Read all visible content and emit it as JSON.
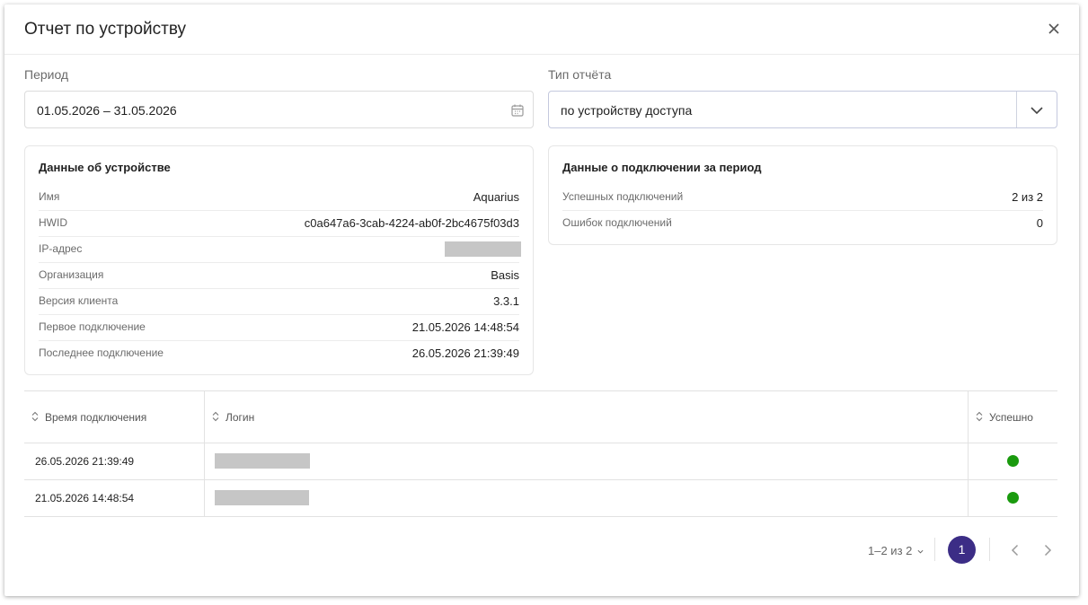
{
  "dialog": {
    "title": "Отчет по устройству"
  },
  "filters": {
    "period_label": "Период",
    "period_value": "01.05.2026 – 31.05.2026",
    "report_type_label": "Тип отчёта",
    "report_type_value": "по устройству доступа"
  },
  "device": {
    "title": "Данные об устройстве",
    "rows": [
      {
        "key": "Имя",
        "value": "Aquarius"
      },
      {
        "key": "HWID",
        "value": "c0a647a6-3cab-4224-ab0f-2bc4675f03d3"
      },
      {
        "key": "IP-адрес",
        "value": ""
      },
      {
        "key": "Организация",
        "value": "Basis"
      },
      {
        "key": "Версия клиента",
        "value": "3.3.1"
      },
      {
        "key": "Первое подключение",
        "value": "21.05.2026 14:48:54"
      },
      {
        "key": "Последнее подключение",
        "value": "26.05.2026 21:39:49"
      }
    ]
  },
  "connections": {
    "title": "Данные о подключении за период",
    "rows": [
      {
        "key": "Успешных подключений",
        "value": "2 из 2"
      },
      {
        "key": "Ошибок подключений",
        "value": "0"
      }
    ]
  },
  "table": {
    "headers": [
      "Время подключения",
      "Логин",
      "Успешно"
    ],
    "rows": [
      {
        "time": "26.05.2026 21:39:49",
        "login": "",
        "success": true
      },
      {
        "time": "21.05.2026 14:48:54",
        "login": "",
        "success": true
      }
    ]
  },
  "pagination": {
    "range": "1–2 из 2",
    "current_page": "1"
  },
  "colors": {
    "accent": "#3c2d86",
    "success": "#1a9a0e"
  },
  "icons": [
    "close-icon",
    "calendar-icon",
    "chevron-down-icon",
    "sort-icon",
    "chevron-left-icon",
    "chevron-right-icon"
  ]
}
